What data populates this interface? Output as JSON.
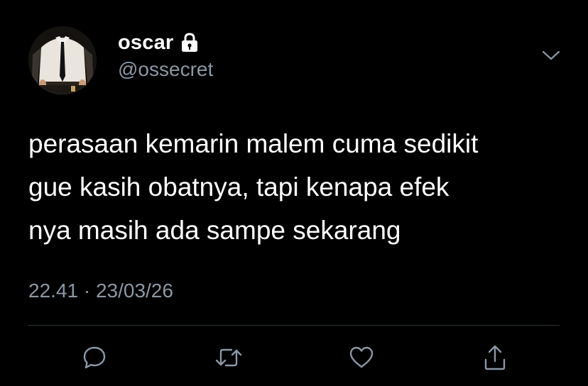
{
  "user": {
    "display_name": "oscar",
    "handle": "@ossecret",
    "avatar_icon": "profile-photo",
    "protected_icon": "lock-icon"
  },
  "tweet": {
    "text": "perasaan kemarin malem cuma sedikit\ngue kasih obatnya, tapi kenapa efek\nnya masih ada sampe sekarang",
    "timestamp": "22.41 · 23/03/26"
  },
  "actions": [
    {
      "name": "reply",
      "icon": "speech-bubble-icon"
    },
    {
      "name": "retweet",
      "icon": "retweet-icon"
    },
    {
      "name": "like",
      "icon": "heart-icon"
    },
    {
      "name": "share",
      "icon": "share-icon"
    }
  ],
  "colors": {
    "background": "#000000",
    "text_primary": "#ffffff",
    "text_secondary": "#8b98a5",
    "divider": "#2f3336"
  }
}
